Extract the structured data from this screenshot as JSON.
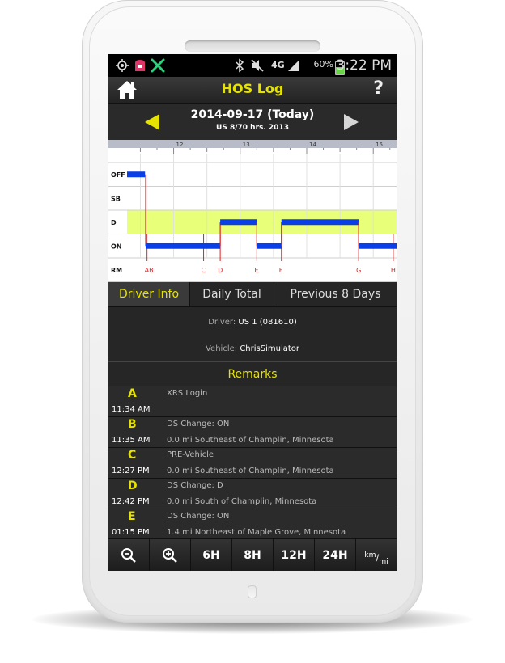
{
  "status_bar": {
    "time": "3:22 PM",
    "battery": "60%",
    "network": "4G",
    "icons": [
      "gps-icon",
      "app-icon",
      "xrs-icon",
      "bluetooth-icon",
      "mute-icon",
      "network-icon",
      "signal-icon",
      "battery-icon"
    ]
  },
  "app_bar": {
    "title": "HOS Log",
    "help": "?",
    "home_icon": "home-icon"
  },
  "date_bar": {
    "date": "2014-09-17 (Today)",
    "subtitle": "US 8/70 hrs. 2013",
    "prev_icon": "arrow-left-icon",
    "next_icon": "arrow-right-icon"
  },
  "hos_graph": {
    "hour_labels": [
      "12",
      "13",
      "14",
      "15"
    ],
    "rows": [
      "OFF",
      "SB",
      "D",
      "ON",
      "RM"
    ],
    "remark_markers": [
      {
        "label": "AB",
        "hour": 11.6
      },
      {
        "label": "C",
        "hour": 12.45
      },
      {
        "label": "D",
        "hour": 12.7
      },
      {
        "label": "E",
        "hour": 13.25
      },
      {
        "label": "F",
        "hour": 13.62
      },
      {
        "label": "G",
        "hour": 14.78
      },
      {
        "label": "H",
        "hour": 15.3
      }
    ],
    "duty_segments": [
      {
        "status": "OFF",
        "start": 11.3,
        "end": 11.57
      },
      {
        "status": "ON",
        "start": 11.58,
        "end": 12.7
      },
      {
        "status": "D",
        "start": 12.7,
        "end": 13.25
      },
      {
        "status": "ON",
        "start": 13.25,
        "end": 13.62
      },
      {
        "status": "D",
        "start": 13.62,
        "end": 14.78
      },
      {
        "status": "ON",
        "start": 14.78,
        "end": 15.35
      }
    ],
    "axis_range": [
      11.3,
      15.35
    ],
    "highlight_row": "D",
    "colors": {
      "duty": "#0a3ee6",
      "change": "#e02020",
      "highlight": "#e8ff7a"
    }
  },
  "tabs": [
    {
      "label": "Driver Info",
      "active": true
    },
    {
      "label": "Daily Total",
      "active": false
    },
    {
      "label": "Previous 8 Days",
      "active": false
    }
  ],
  "driver_info": {
    "driver_label": "Driver:",
    "driver_value": "US 1 (081610)",
    "vehicle_label": "Vehicle:",
    "vehicle_value": "ChrisSimulator"
  },
  "remarks_header": "Remarks",
  "remarks": [
    {
      "letter": "A",
      "text": "XRS Login",
      "time": "11:34 AM",
      "location": ""
    },
    {
      "letter": "B",
      "text": "DS Change: ON",
      "time": "11:35 AM",
      "location": "0.0 mi Southeast of Champlin, Minnesota"
    },
    {
      "letter": "C",
      "text": "PRE-Vehicle",
      "time": "12:27 PM",
      "location": "0.0 mi Southeast of Champlin, Minnesota"
    },
    {
      "letter": "D",
      "text": "DS Change: D",
      "time": "12:42 PM",
      "location": "0.0 mi South of Champlin, Minnesota"
    },
    {
      "letter": "E",
      "text": "DS Change: ON",
      "time": "01:15 PM",
      "location": "1.4 mi Northeast of Maple Grove, Minnesota"
    }
  ],
  "toolbar": {
    "zoom_out_icon": "zoom-out-icon",
    "zoom_in_icon": "zoom-in-icon",
    "b6h": "6H",
    "b8h": "8H",
    "b12h": "12H",
    "b24h": "24H",
    "units_top": "km",
    "units_bottom": "mi"
  },
  "colors": {
    "accent": "#e6e300",
    "background": "#262626"
  }
}
